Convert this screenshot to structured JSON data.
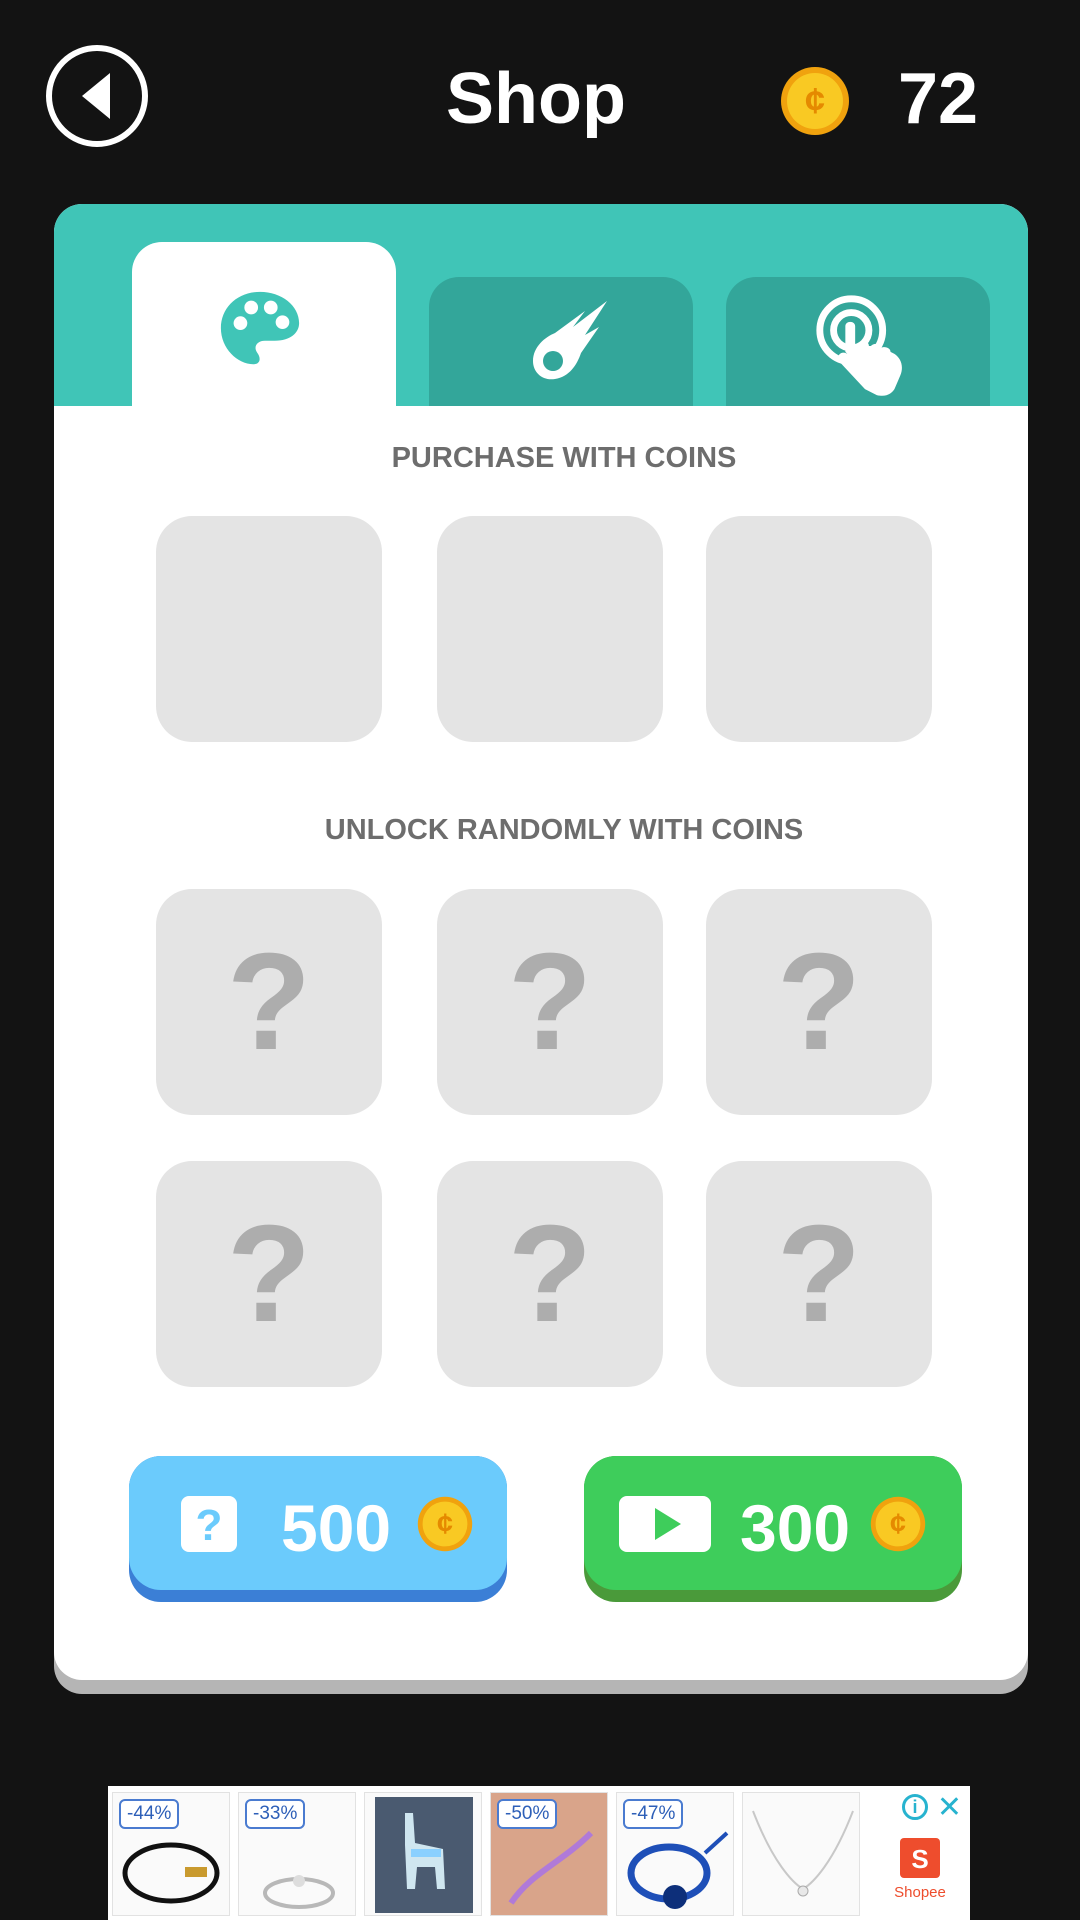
{
  "header": {
    "title": "Shop",
    "coins": "72",
    "back_icon": "back-arrow-icon",
    "coin_icon": "coin-icon"
  },
  "tabs": [
    {
      "name": "colors",
      "icon": "palette-icon",
      "active": true
    },
    {
      "name": "trails",
      "icon": "comet-icon",
      "active": false
    },
    {
      "name": "effects",
      "icon": "tap-icon",
      "active": false
    }
  ],
  "sections": {
    "purchase_label": "PURCHASE WITH COINS",
    "random_label": "UNLOCK RANDOMLY WITH COINS"
  },
  "locked_symbol": "?",
  "buttons": {
    "random_unlock": {
      "price": "500",
      "icon": "question-square-icon"
    },
    "watch_ad": {
      "price": "300",
      "icon": "play-video-icon"
    }
  },
  "ad": {
    "badges": [
      "-44%",
      "-33%",
      "-50%",
      "-47%"
    ],
    "info": "i",
    "close": "✕",
    "brand": "Shopee",
    "brand_mark": "S"
  },
  "colors": {
    "background": "#131313",
    "teal": "#40c5b7",
    "tab_inactive": "#33a69a",
    "tile": "#e4e4e4",
    "blue_button": "#6bcbfc",
    "green_button": "#3ecd5b",
    "coin": "#f7c21d"
  }
}
